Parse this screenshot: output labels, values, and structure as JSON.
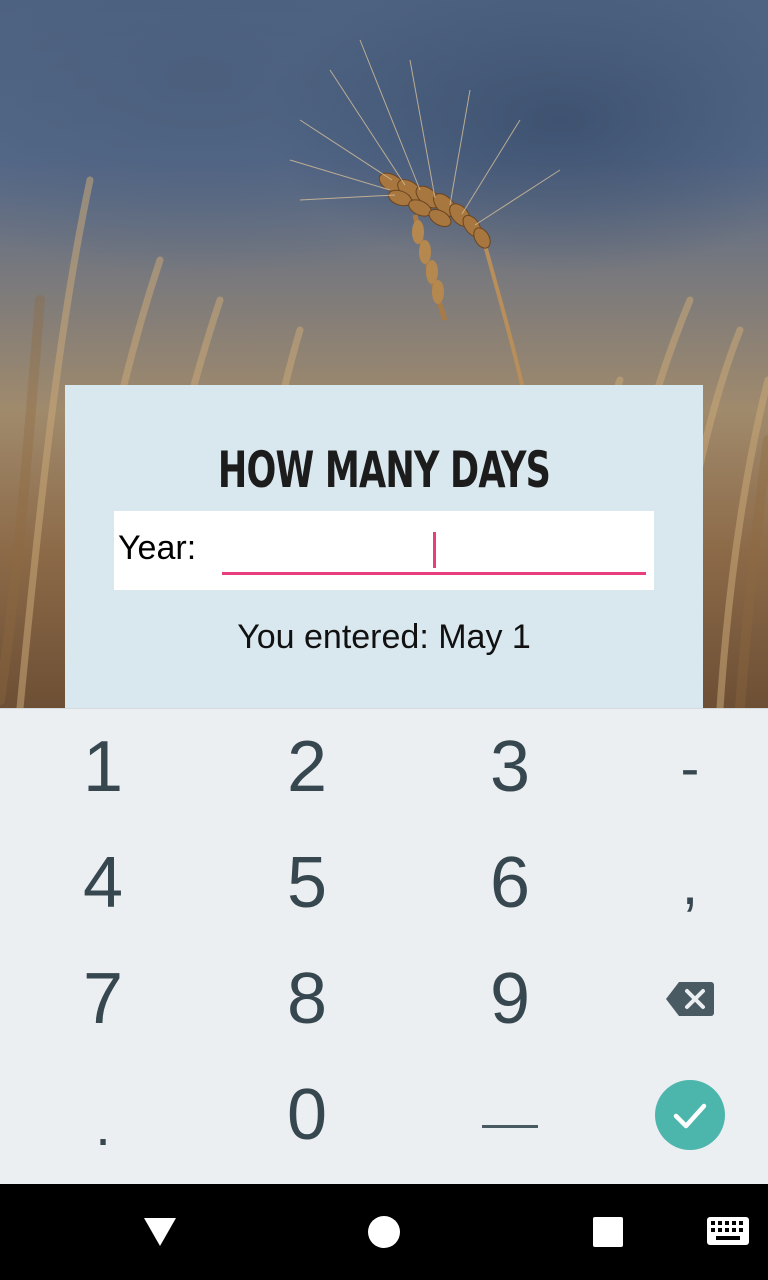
{
  "app": {
    "title": "HOW MANY DAYS",
    "year_label": "Year:",
    "year_value": "",
    "entered_text": "You entered: May 1"
  },
  "keyboard": {
    "rows": [
      [
        "1",
        "2",
        "3",
        "-"
      ],
      [
        "4",
        "5",
        "6",
        ","
      ],
      [
        "7",
        "8",
        "9",
        "backspace"
      ],
      [
        ".",
        "0",
        "space",
        "done"
      ]
    ],
    "accent": "#4db6ac"
  },
  "colors": {
    "input_accent": "#e83e7d",
    "card_bg": "#d9e7ee",
    "keyboard_bg": "#ebeff2"
  },
  "navbar": {
    "icons": [
      "back-icon",
      "home-icon",
      "recents-icon",
      "keyboard-icon"
    ]
  }
}
